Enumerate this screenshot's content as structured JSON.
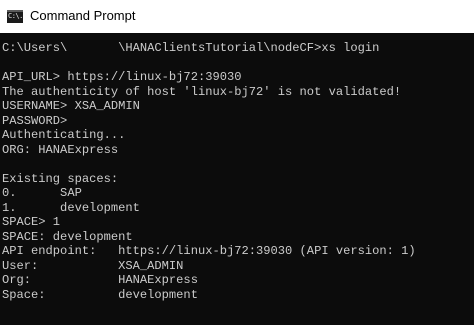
{
  "window": {
    "title": "Command Prompt",
    "icon": "cmd-icon",
    "icon_glyph": "C:\\."
  },
  "console": {
    "colors": {
      "background": "#0c0c0c",
      "text": "#cccccc"
    },
    "lines": [
      "C:\\Users\\       \\HANAClientsTutorial\\nodeCF>xs login",
      "",
      "API_URL> https://linux-bj72:39030",
      "The authenticity of host 'linux-bj72' is not validated!",
      "USERNAME> XSA_ADMIN",
      "PASSWORD>",
      "Authenticating...",
      "ORG: HANAExpress",
      "",
      "Existing spaces:",
      "0.      SAP",
      "1.      development",
      "SPACE> 1",
      "SPACE: development",
      "API endpoint:   https://linux-bj72:39030 (API version: 1)",
      "User:           XSA_ADMIN",
      "Org:            HANAExpress",
      "Space:          development"
    ]
  }
}
